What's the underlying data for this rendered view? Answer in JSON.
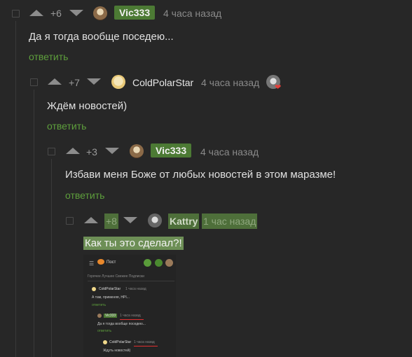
{
  "comments": [
    {
      "rating": "+6",
      "nick": "Vic333",
      "time": "4 часа назад",
      "text": "Да я тогда вообще поседею...",
      "reply": "ответить"
    },
    {
      "rating": "+7",
      "nick": "ColdPolarStar",
      "time": "4 часа назад",
      "text": "Ждём новостей)",
      "reply": "ответить"
    },
    {
      "rating": "+3",
      "nick": "Vic333",
      "time": "4 часа назад",
      "text": "Избави меня Боже от любых новостей в этом маразме!",
      "reply": "ответить"
    },
    {
      "rating": "+8",
      "nick": "Kattry",
      "time": "1 час назад",
      "text": "Как ты это сделал?!"
    }
  ],
  "screenshot": {
    "header": "Пост",
    "tabs": "Горячее  Лучшее  Свежее  Подписки",
    "c1_nick": "ColdPolarStar",
    "c1_time": "1 часа назад",
    "c1_text": "А там, применяя, НРІ...",
    "c1_reply": "ответить",
    "c2_nick": "Vic333",
    "c2_time": "1 часа назад",
    "c2_text": "Да я тогда вообще поседею...",
    "c2_reply": "ответить",
    "c3_nick": "ColdPolarStar",
    "c3_time": "1 часа назад",
    "c3_text": "Ждуть новостей)"
  },
  "colors": {
    "background": "#272727",
    "nick_badge": "#4c7a34",
    "reply_link": "#5e9f3c",
    "highlight": "#6d8f56"
  }
}
